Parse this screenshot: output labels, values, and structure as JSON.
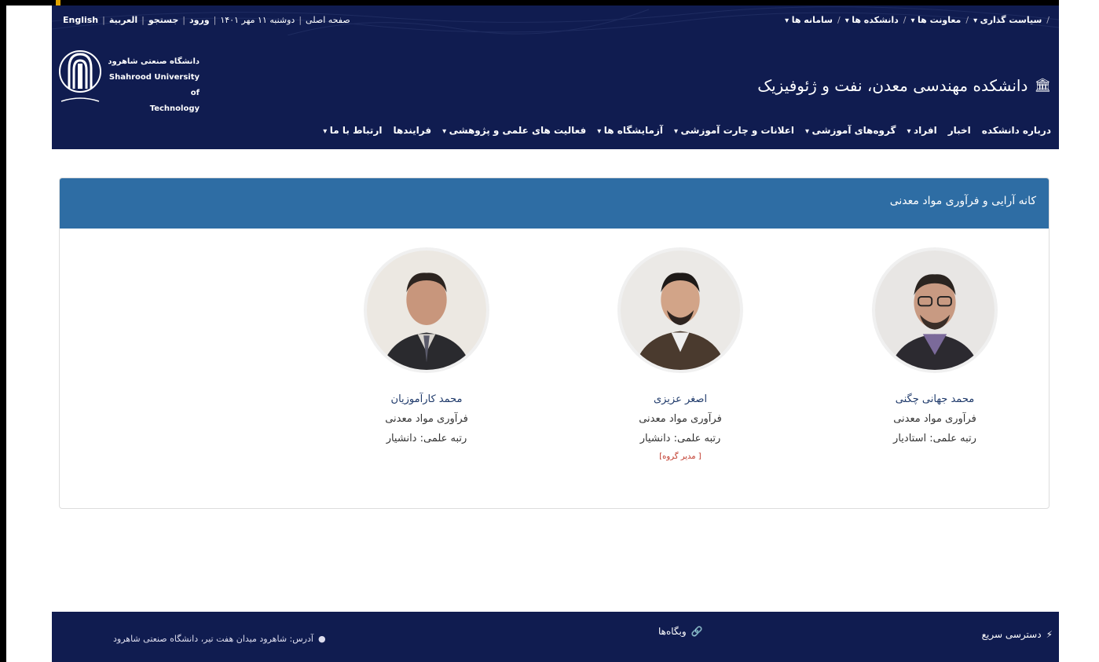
{
  "topbar": {
    "left": {
      "english": "English",
      "arabic": "العربية",
      "search": "جستجو",
      "login": "ورود",
      "date": "دوشنبه ۱۱ مهر ۱۴۰۱",
      "home": "صفحه اصلی"
    },
    "right": {
      "policy": "سیاست گذاری",
      "deputies": "معاونت ها",
      "faculties": "دانشکده ها",
      "systems": "سامانه ها"
    }
  },
  "university": {
    "name_fa": "دانشگاه صنعتی شاهرود",
    "name_en_1": "Shahrood University of",
    "name_en_2": "Technology"
  },
  "faculty": {
    "title": "دانشکده مهندسی معدن، نفت و ژئوفیزیک",
    "icon": "bank-icon"
  },
  "mainnav": [
    {
      "label": "درباره دانشکده",
      "caret": false
    },
    {
      "label": "اخبار",
      "caret": false
    },
    {
      "label": "افراد",
      "caret": true
    },
    {
      "label": "گروه‌های آموزشی",
      "caret": true
    },
    {
      "label": "اعلانات و چارت آموزشی",
      "caret": true
    },
    {
      "label": "آزمایشگاه ها",
      "caret": true
    },
    {
      "label": "فعالیت های علمی و پژوهشی",
      "caret": true
    },
    {
      "label": "فرایندها",
      "caret": false
    },
    {
      "label": "ارتباط با ما",
      "caret": true
    }
  ],
  "panel": {
    "title": "کانه آرایی و فرآوری مواد معدنی"
  },
  "people": [
    {
      "name": "محمد جهانی چگنی",
      "group": "فرآوری مواد معدنی",
      "rank": "رتبه علمی: استادیار",
      "badge": ""
    },
    {
      "name": "اصغر عزیزی",
      "group": "فرآوری مواد معدنی",
      "rank": "رتبه علمی: دانشیار",
      "badge": "[ مدیر گروه]"
    },
    {
      "name": "محمد کارآموزیان",
      "group": "فرآوری مواد معدنی",
      "rank": "رتبه علمی: دانشیار",
      "badge": ""
    }
  ],
  "footer": {
    "quick_access": "دسترسی سریع",
    "websites": "وبگاه‌ها",
    "address": "آدرس: شاهرود میدان هفت تیر، دانشگاه صنعتی شاهرود"
  },
  "colors": {
    "navy": "#101c50",
    "panel_head": "#2e6da4",
    "badge": "#c0392b"
  }
}
